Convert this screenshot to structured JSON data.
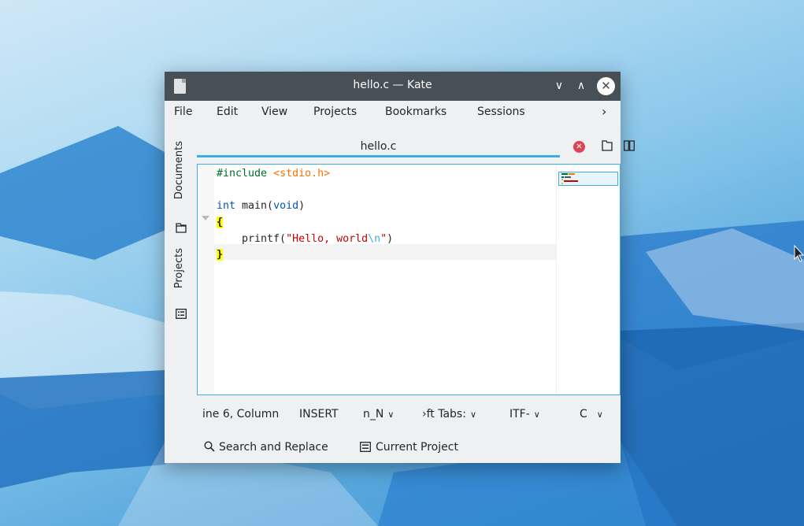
{
  "window": {
    "title": "hello.c — Kate"
  },
  "titlebar_buttons": {
    "minimize": "∨",
    "maximize": "∧",
    "close": "✕"
  },
  "menubar": {
    "items": [
      "File",
      "Edit",
      "View",
      "Projects",
      "Bookmarks",
      "Sessions"
    ],
    "overflow": "›"
  },
  "sidebar": {
    "tabs": [
      {
        "label": "Documents",
        "icon": "folder-icon"
      },
      {
        "label": "Projects",
        "icon": "project-list-icon"
      }
    ]
  },
  "tabbar": {
    "active_tab": "hello.c",
    "close_icon": "✕"
  },
  "editor": {
    "lines": [
      "#include <stdio.h>",
      "",
      "int main(void)",
      "{",
      "    printf(\"Hello, world\\n\")",
      "}"
    ],
    "code_parts": {
      "l1_directive": "#include",
      "l1_header": "<stdio.h>",
      "l3_type": "int",
      "l3_name": " main(",
      "l3_void": "void",
      "l3_close": ")",
      "l4_brace": "{",
      "l5_indent": "    printf(",
      "l5_str1": "\"Hello, world",
      "l5_esc": "\\n",
      "l5_str2": "\"",
      "l5_close": ")",
      "l6_brace": "}"
    }
  },
  "statusbar": {
    "position": "ine 6, Column",
    "mode": "INSERT",
    "line_endings": "n_N",
    "indent": "›ft Tabs:",
    "encoding": "ITF-",
    "syntax": "C"
  },
  "bottombar": {
    "search_replace": "Search and Replace",
    "current_project": "Current Project"
  },
  "colors": {
    "accent": "#3daee9",
    "titlebar": "#475057",
    "close_tab": "#da4453"
  }
}
